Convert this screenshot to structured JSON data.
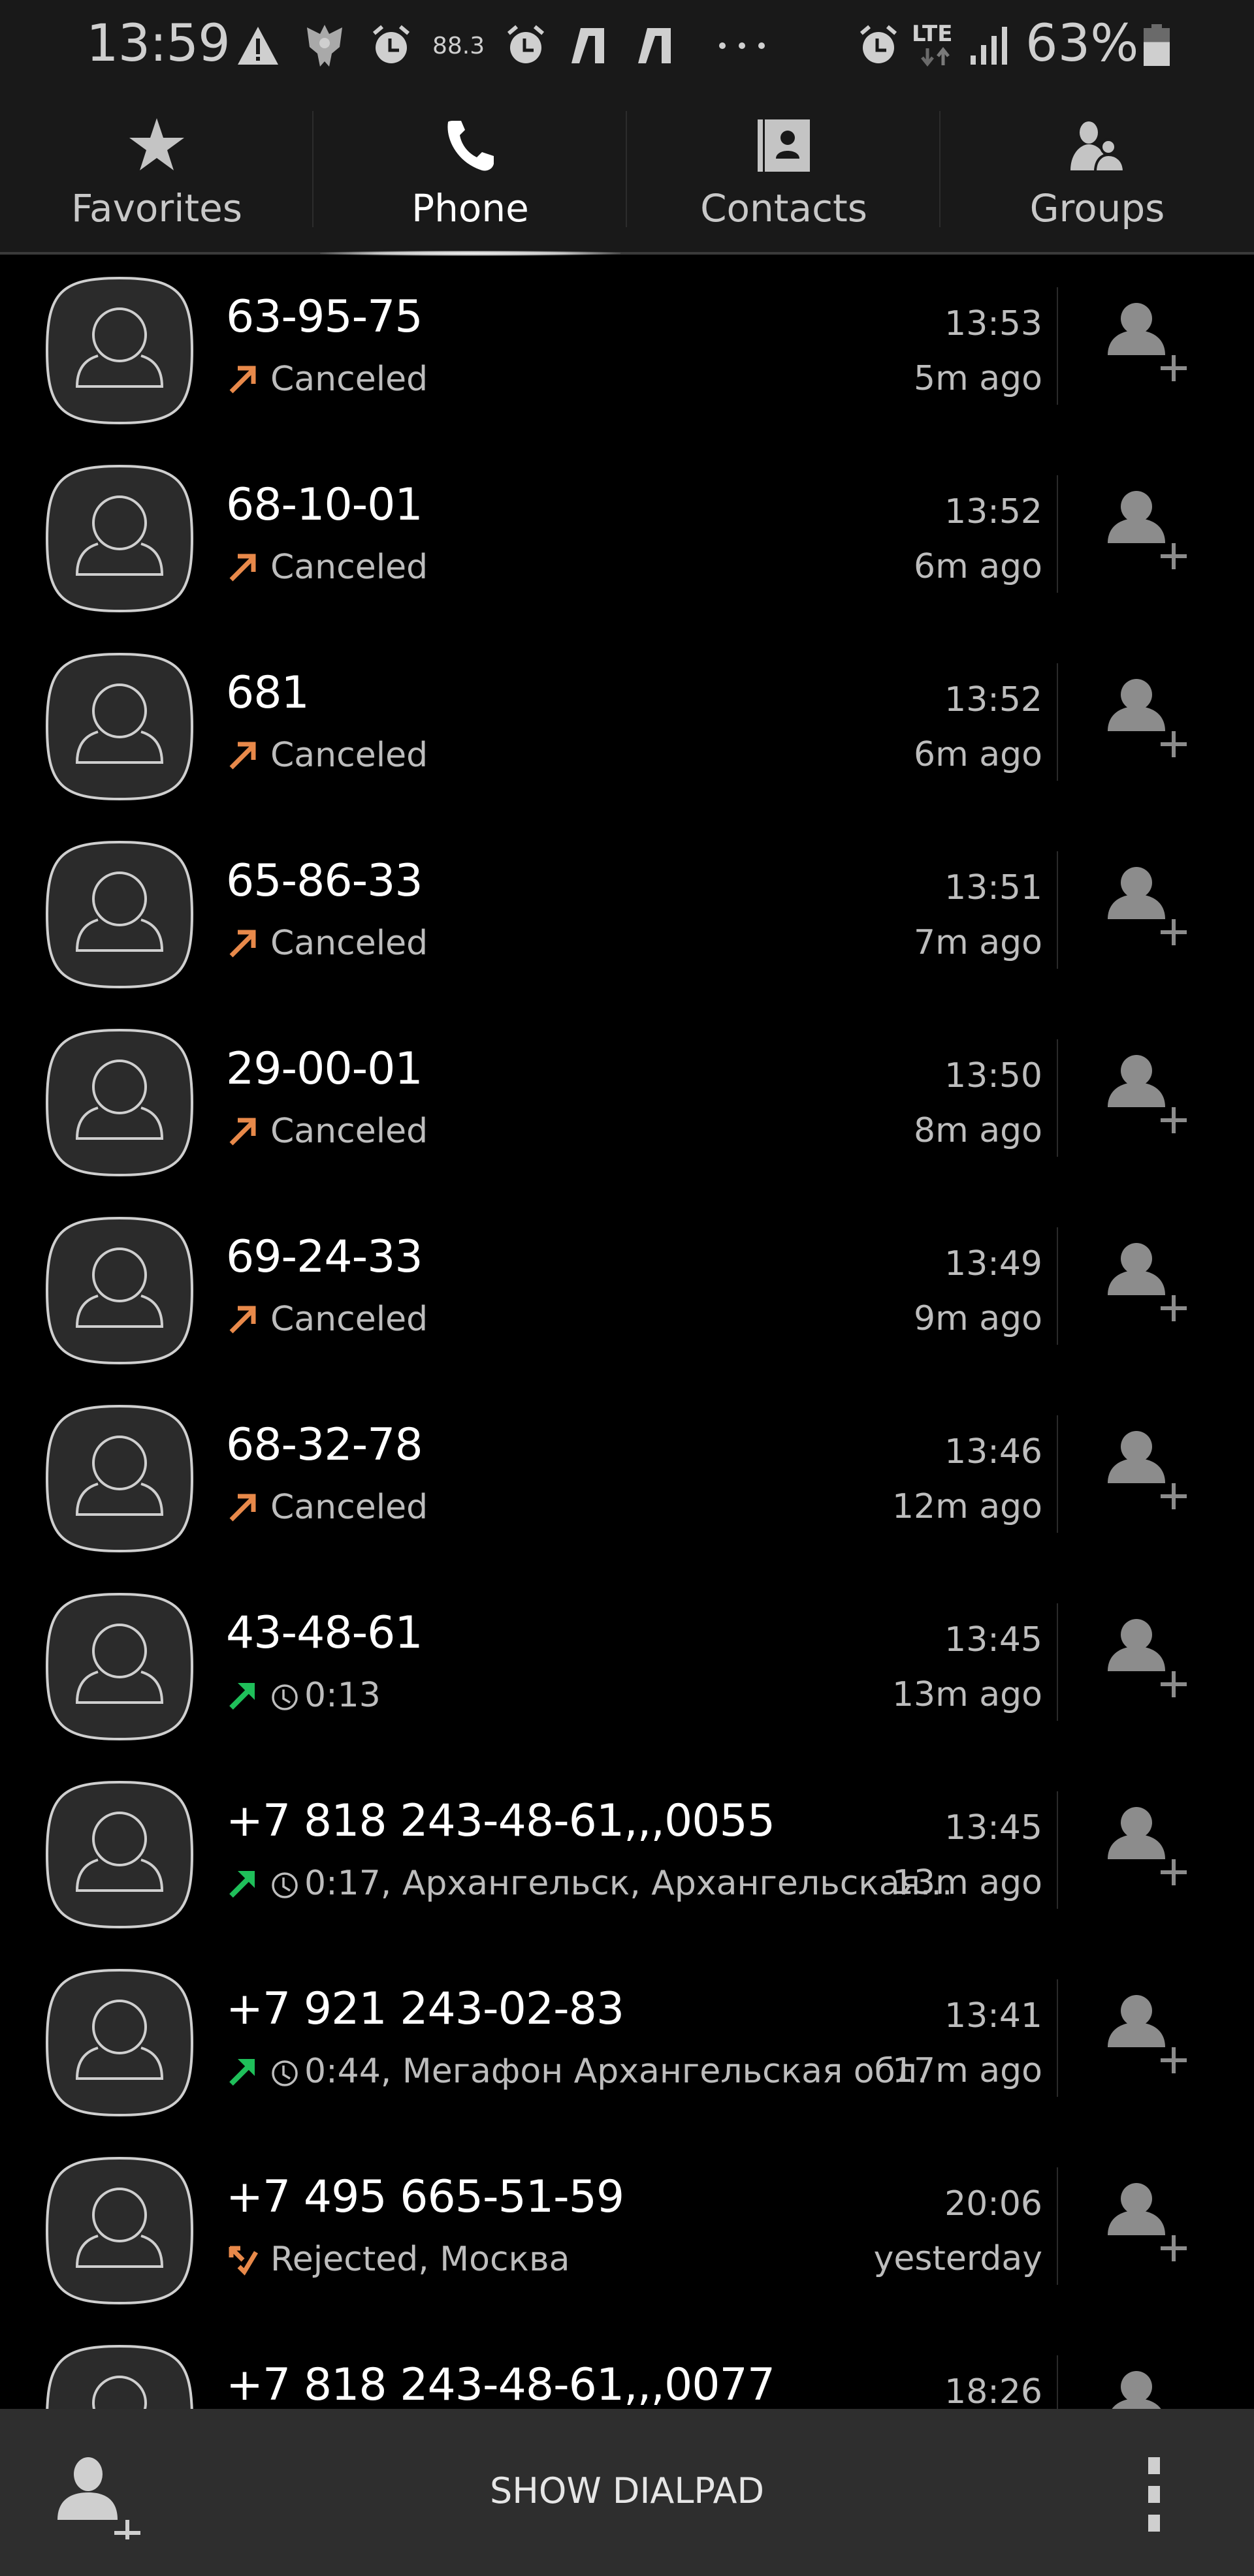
{
  "status_bar": {
    "time": "13:59",
    "fm_frequency": "88.3",
    "network": "LTE",
    "battery_percent": "63%",
    "battery_level": 0.63,
    "icons": [
      "warning-icon",
      "coat-of-arms-icon",
      "alarm-icon",
      "radio-icon",
      "alarm-icon",
      "app-icon",
      "app-icon",
      "more-notifications-icon",
      "alarm-icon",
      "lte-icon",
      "signal-icon",
      "battery-icon"
    ]
  },
  "tabs": [
    {
      "label": "Favorites",
      "icon": "star-icon",
      "active": false
    },
    {
      "label": "Phone",
      "icon": "phone-icon",
      "active": true
    },
    {
      "label": "Contacts",
      "icon": "contact-card-icon",
      "active": false
    },
    {
      "label": "Groups",
      "icon": "group-icon",
      "active": false
    }
  ],
  "colors": {
    "outgoing_canceled": "#e8894a",
    "outgoing_connected": "#1fbf5a",
    "rejected": "#e8894a",
    "background": "#000000",
    "bar_background": "#191919",
    "bottom_bar_background": "#2e2e2e"
  },
  "calls": [
    {
      "number": "63-95-75",
      "type": "canceled",
      "detail": "Canceled",
      "duration": "",
      "time": "13:53",
      "ago": "5m ago"
    },
    {
      "number": "68-10-01",
      "type": "canceled",
      "detail": "Canceled",
      "duration": "",
      "time": "13:52",
      "ago": "6m ago"
    },
    {
      "number": "681",
      "type": "canceled",
      "detail": "Canceled",
      "duration": "",
      "time": "13:52",
      "ago": "6m ago"
    },
    {
      "number": "65-86-33",
      "type": "canceled",
      "detail": "Canceled",
      "duration": "",
      "time": "13:51",
      "ago": "7m ago"
    },
    {
      "number": "29-00-01",
      "type": "canceled",
      "detail": "Canceled",
      "duration": "",
      "time": "13:50",
      "ago": "8m ago"
    },
    {
      "number": "69-24-33",
      "type": "canceled",
      "detail": "Canceled",
      "duration": "",
      "time": "13:49",
      "ago": "9m ago"
    },
    {
      "number": "68-32-78",
      "type": "canceled",
      "detail": "Canceled",
      "duration": "",
      "time": "13:46",
      "ago": "12m ago"
    },
    {
      "number": "43-48-61",
      "type": "outgoing",
      "detail": "0:13",
      "duration": "0:13",
      "time": "13:45",
      "ago": "13m ago"
    },
    {
      "number": "+7 818 243-48-61,,,0055",
      "type": "outgoing",
      "detail": "0:17, Архангельск, Архангельская...",
      "duration": "0:17",
      "time": "13:45",
      "ago": "13m ago"
    },
    {
      "number": "+7 921 243-02-83",
      "type": "outgoing",
      "detail": "0:44, Мегафон Архангельская обл.",
      "duration": "0:44",
      "time": "13:41",
      "ago": "17m ago"
    },
    {
      "number": "+7 495 665-51-59",
      "type": "rejected",
      "detail": "Rejected, Москва",
      "duration": "",
      "time": "20:06",
      "ago": "yesterday"
    },
    {
      "number": "+7 818 243-48-61,,,0077",
      "type": "partial",
      "detail": "",
      "duration": "",
      "time": "18:26",
      "ago": ""
    }
  ],
  "bottom_bar": {
    "show_dialpad_label": "SHOW DIALPAD",
    "add_contact_icon": "add-contact-icon",
    "more_icon": "more-options-icon"
  }
}
